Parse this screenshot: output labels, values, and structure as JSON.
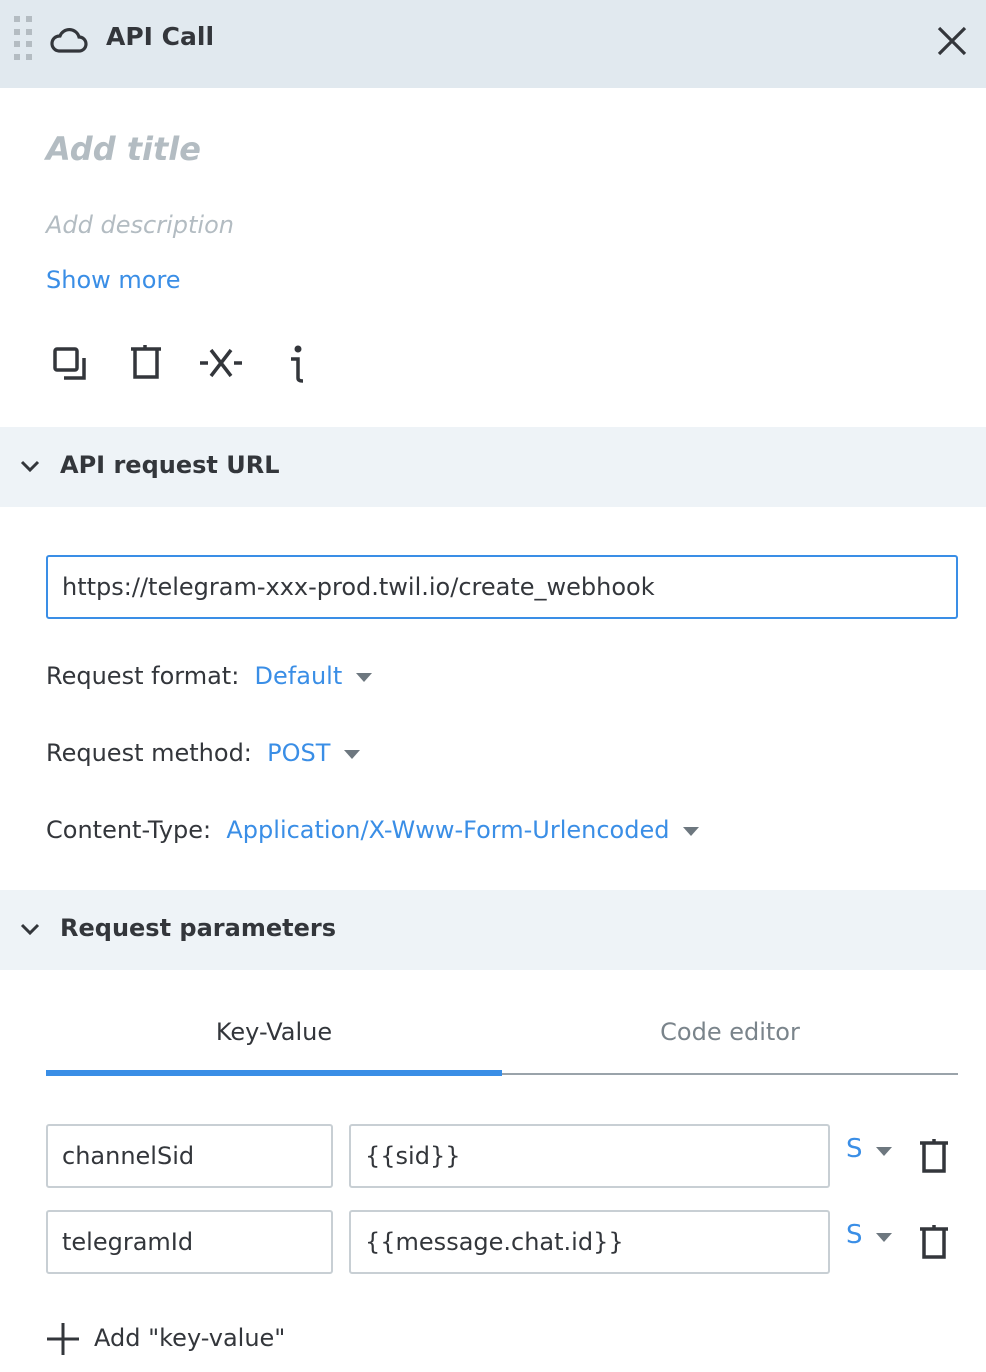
{
  "header": {
    "title": "API Call",
    "icon": "cloud-icon"
  },
  "meta": {
    "title_placeholder": "Add title",
    "description_placeholder": "Add description",
    "show_more": "Show more"
  },
  "toolbar": {
    "icons": [
      "copy-icon",
      "delete-icon",
      "disconnect-icon",
      "info-icon"
    ]
  },
  "url_section": {
    "title": "API request URL",
    "url": "https://telegram-xxx-prod.twil.io/create_webhook",
    "format_label": "Request format:",
    "format_value": "Default",
    "method_label": "Request method:",
    "method_value": "POST",
    "content_type_label": "Content-Type:",
    "content_type_value": "Application/X-Www-Form-Urlencoded"
  },
  "params_section": {
    "title": "Request parameters",
    "tabs": [
      {
        "label": "Key-Value",
        "active": true
      },
      {
        "label": "Code editor",
        "active": false
      }
    ],
    "rows": [
      {
        "key": "channelSid",
        "value": "{{sid}}",
        "type": "S"
      },
      {
        "key": "telegramId",
        "value": "{{message.chat.id}}",
        "type": "S"
      }
    ],
    "add_label": "Add \"key-value\""
  },
  "colors": {
    "accent": "#3a8ee6",
    "header_bg": "#e1e9ef",
    "section_bg": "#eef3f7"
  }
}
